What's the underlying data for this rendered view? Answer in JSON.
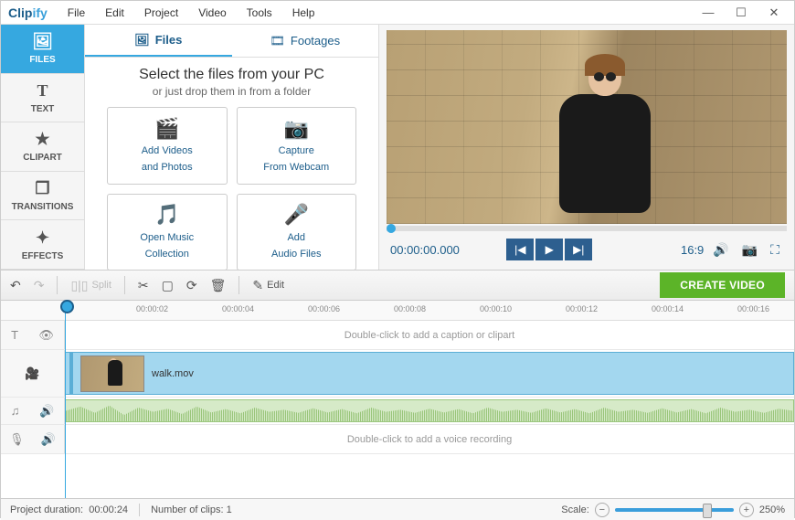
{
  "app": {
    "name_a": "Clip",
    "name_b": "ify"
  },
  "menu": [
    "File",
    "Edit",
    "Project",
    "Video",
    "Tools",
    "Help"
  ],
  "sidebar": [
    {
      "label": "FILES",
      "icon": "🖼"
    },
    {
      "label": "TEXT",
      "icon": "T"
    },
    {
      "label": "CLIPART",
      "icon": "★"
    },
    {
      "label": "TRANSITIONS",
      "icon": "❐"
    },
    {
      "label": "EFFECTS",
      "icon": "✦"
    }
  ],
  "panel": {
    "tabs": [
      {
        "label": "Files",
        "icon": "🖼"
      },
      {
        "label": "Footages",
        "icon": "🎞"
      }
    ],
    "title": "Select the files from your PC",
    "subtitle": "or just drop them in from a folder",
    "options": [
      {
        "l1": "Add Videos",
        "l2": "and Photos",
        "icon": "🎬"
      },
      {
        "l1": "Capture",
        "l2": "From Webcam",
        "icon": "📷"
      },
      {
        "l1": "Open Music",
        "l2": "Collection",
        "icon": "🎵"
      },
      {
        "l1": "Add",
        "l2": "Audio Files",
        "icon": "🎤"
      }
    ]
  },
  "preview": {
    "timecode": "00:00:00.000",
    "ratio": "16:9"
  },
  "toolbar": {
    "split": "Split",
    "edit": "Edit",
    "create": "CREATE VIDEO"
  },
  "ruler": [
    "00:00:02",
    "00:00:04",
    "00:00:06",
    "00:00:08",
    "00:00:10",
    "00:00:12",
    "00:00:14",
    "00:00:16"
  ],
  "tracks": {
    "caption_hint": "Double-click to add a caption or clipart",
    "clip_name": "walk.mov",
    "voice_hint": "Double-click to add a voice recording"
  },
  "status": {
    "duration_label": "Project duration:",
    "duration_value": "00:00:24",
    "clips_label": "Number of clips:",
    "clips_value": "1",
    "scale_label": "Scale:",
    "scale_value": "250%"
  }
}
